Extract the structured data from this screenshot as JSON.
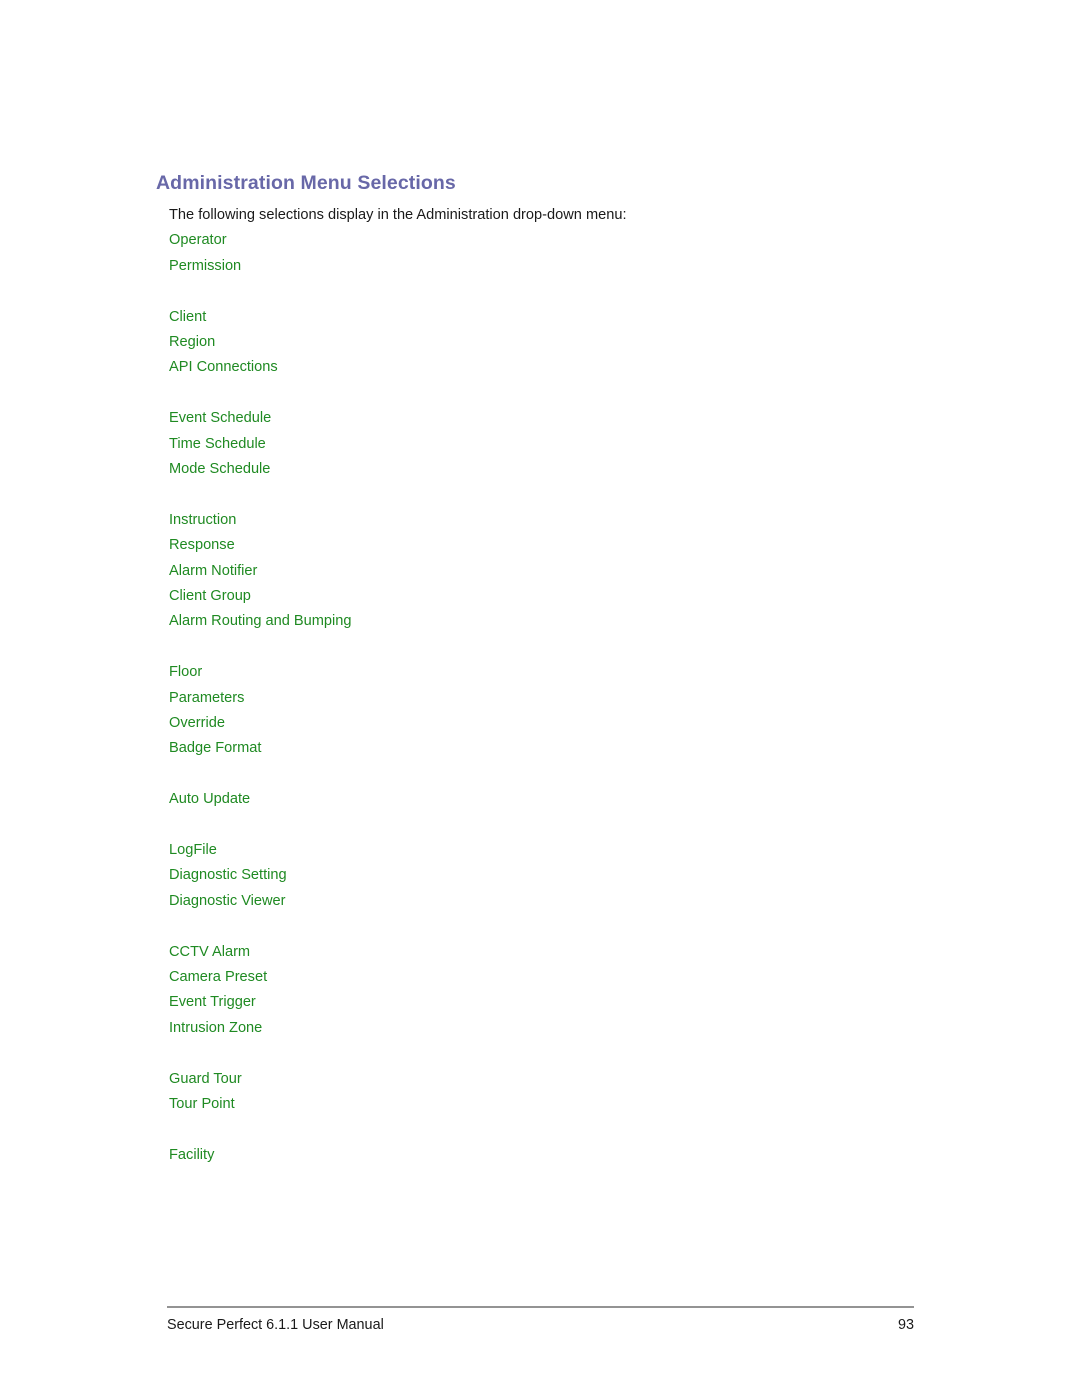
{
  "document": {
    "heading": "Administration Menu Selections",
    "intro": "The following selections display in the Administration drop-down menu:",
    "accent_heading_color": "#6868a8",
    "link_color": "#1f8a22",
    "body_color": "#1a1a1a",
    "rule_color": "#939393",
    "background_color": "#ffffff"
  },
  "menu_groups": [
    {
      "items": [
        {
          "label": "Operator"
        },
        {
          "label": "Permission"
        }
      ]
    },
    {
      "items": [
        {
          "label": "Client"
        },
        {
          "label": "Region"
        },
        {
          "label": "API Connections"
        }
      ]
    },
    {
      "items": [
        {
          "label": "Event Schedule"
        },
        {
          "label": "Time Schedule"
        },
        {
          "label": "Mode Schedule"
        }
      ]
    },
    {
      "items": [
        {
          "label": "Instruction"
        },
        {
          "label": "Response"
        },
        {
          "label": "Alarm Notifier"
        },
        {
          "label": "Client Group"
        },
        {
          "label": "Alarm Routing and Bumping"
        }
      ]
    },
    {
      "items": [
        {
          "label": "Floor"
        },
        {
          "label": "Parameters"
        },
        {
          "label": "Override"
        },
        {
          "label": "Badge Format"
        }
      ]
    },
    {
      "items": [
        {
          "label": "Auto Update"
        }
      ]
    },
    {
      "items": [
        {
          "label": "LogFile"
        },
        {
          "label": "Diagnostic Setting"
        },
        {
          "label": "Diagnostic Viewer"
        }
      ]
    },
    {
      "items": [
        {
          "label": "CCTV Alarm"
        },
        {
          "label": "Camera Preset"
        },
        {
          "label": "Event Trigger"
        },
        {
          "label": "Intrusion Zone"
        }
      ]
    },
    {
      "items": [
        {
          "label": "Guard Tour"
        },
        {
          "label": "Tour Point"
        }
      ]
    },
    {
      "items": [
        {
          "label": "Facility"
        }
      ]
    }
  ],
  "footer": {
    "title": "Secure Perfect 6.1.1 User Manual",
    "page_number": "93"
  }
}
